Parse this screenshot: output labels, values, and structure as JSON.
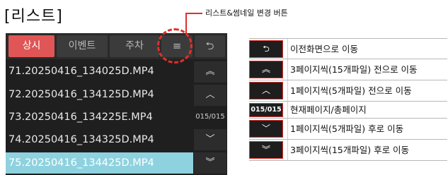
{
  "title": "[리스트]",
  "callout": {
    "label": "리스트&썸네일 변경 버튼"
  },
  "tabs": [
    {
      "label": "상시",
      "active": true
    },
    {
      "label": "이벤트",
      "active": false
    },
    {
      "label": "주차",
      "active": false
    }
  ],
  "toolbar": {
    "menu_icon": "≡",
    "back_icon": "⮌"
  },
  "files": [
    {
      "name": "71.20250416_134025D.MP4",
      "selected": false
    },
    {
      "name": "72.20250416_134125D.MP4",
      "selected": false
    },
    {
      "name": "73.20250416_134225E.MP4",
      "selected": false
    },
    {
      "name": "74.20250416_134325D.MP4",
      "selected": false
    },
    {
      "name": "75.20250416_134425D.MP4",
      "selected": true
    }
  ],
  "nav": {
    "prev15_icon": "≈",
    "prev5_icon": "^",
    "page": "015/015",
    "next5_icon": "v",
    "next15_icon": "≈"
  },
  "legend": [
    {
      "icon": "⮌",
      "text": "이전화면으로 이동"
    },
    {
      "icon": "︽",
      "text": "3페이지씩(15개파일) 전으로 이동"
    },
    {
      "icon": "︿",
      "text": "1페이지씩(5개파일) 전으로 이동"
    },
    {
      "icon": "015/015",
      "text": "현재페이지/총페이지"
    },
    {
      "icon": "﹀",
      "text": "1페이지씩(5개파일) 후로 이동"
    },
    {
      "icon": "︾",
      "text": "3페이지씩(15개파일) 후로 이동"
    }
  ],
  "colors": {
    "accent": "#e05555",
    "selected_row": "#8fd2df",
    "callout": "#e0302a",
    "panel": "#1f1f1f"
  }
}
